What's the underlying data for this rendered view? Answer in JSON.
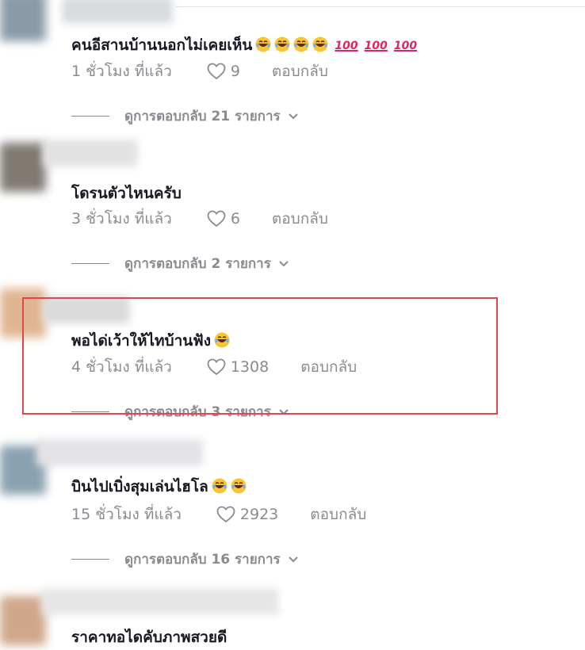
{
  "comments": [
    {
      "text": "คนอีสานบ้านนอกไม่เคยเห็น",
      "time": "1 ชั่วโมง ที่แล้ว",
      "likes": "9",
      "reply": "ตอบกลับ",
      "replies_label": "ดูการตอบกลับ 21 รายการ"
    },
    {
      "text": "โดรนตัวไหนครับ",
      "time": "3 ชั่วโมง ที่แล้ว",
      "likes": "6",
      "reply": "ตอบกลับ",
      "replies_label": "ดูการตอบกลับ 2 รายการ"
    },
    {
      "text": "พอได่เว้าให้ไทบ้านฟัง",
      "time": "4 ชั่วโมง ที่แล้ว",
      "likes": "1308",
      "reply": "ตอบกลับ",
      "replies_label": "ดูการตอบกลับ 3 รายการ"
    },
    {
      "text": "บินไปเบิ่งสุมเล่นไฮโล",
      "time": "15 ชั่วโมง ที่แล้ว",
      "likes": "2923",
      "reply": "ตอบกลับ",
      "replies_label": "ดูการตอบกลับ 16 รายการ"
    },
    {
      "text": "ราคาทอไดคับภาพสวยดี"
    }
  ],
  "emoji": {
    "laugh": "laughing-with-tears",
    "hundred_text": "100"
  },
  "colors": {
    "highlight": "#e0474d",
    "text": "#161823",
    "muted": "#8a8b91"
  }
}
